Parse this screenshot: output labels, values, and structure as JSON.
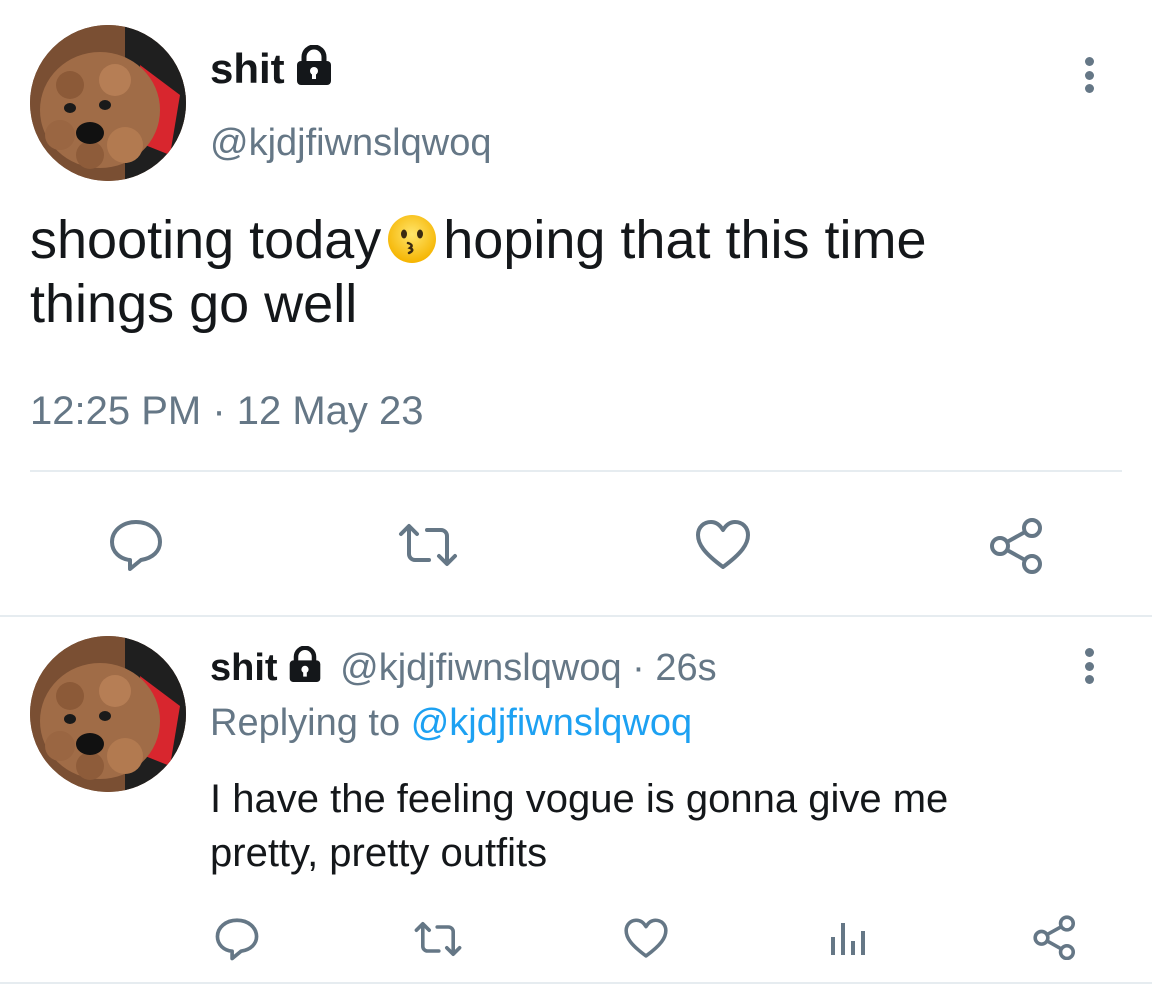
{
  "tweet": {
    "display_name": "shit",
    "handle": "@kjdjfiwnslqwoq",
    "text_before_emoji": "shooting today",
    "emoji": "kissing-face",
    "text_after_emoji": "hoping that this time",
    "text_line2": "things go well",
    "timestamp": "12:25 PM · 12 May 23",
    "actions": [
      "reply-icon",
      "retweet-icon",
      "like-icon",
      "share-icon"
    ]
  },
  "reply": {
    "display_name": "shit",
    "handle": "@kjdjfiwnslqwoq",
    "time": "· 26s",
    "replying_prefix": "Replying to",
    "replying_handle": "@kjdjfiwnslqwoq",
    "text_line1": "I have the feeling vogue is gonna give me",
    "text_line2": "pretty, pretty outfits",
    "actions": [
      "reply-icon",
      "retweet-icon",
      "like-icon",
      "analytics-icon",
      "share-icon"
    ]
  },
  "colors": {
    "text": "#14171a",
    "muted": "#657786",
    "link": "#1da1f2",
    "divider": "#e6ecf0"
  }
}
